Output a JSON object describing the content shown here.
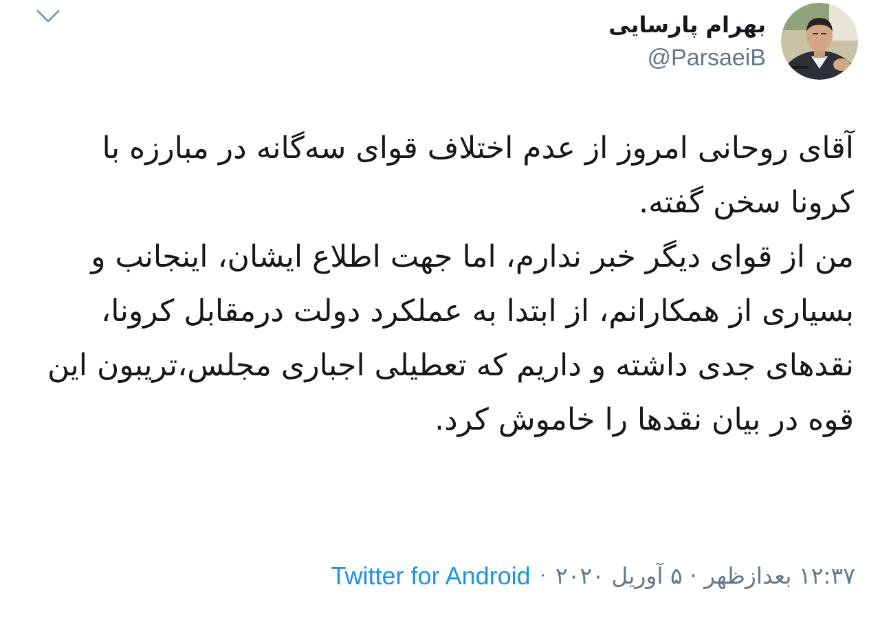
{
  "tweet": {
    "author": {
      "display_name": "بهرام پارسایی",
      "handle": "@ParsaeiB"
    },
    "paragraphs": [
      "آقای روحانی امروز از عدم اختلاف قوای سه‌گانه در مبارزه با کرونا سخن گفته.",
      "من از قوای دیگر خبر ندارم، اما جهت اطلاع ایشان، اینجانب و بسیاری از همکارانم، از ابتدا به عملکرد دولت درمقابل کرونا، نقدهای جدی داشته و داریم که تعطیلی اجباری مجلس،تریبون این قوه در بیان نقدها را خاموش کرد."
    ],
    "timestamp": "۱۲:۳۷ بعدازظهر · ۵ آوریل ۲۰۲۰",
    "separator": "·",
    "source": "Twitter for Android"
  },
  "colors": {
    "text": "#14171a",
    "secondary": "#657786",
    "link": "#1b95e0"
  },
  "icons": {
    "menu": "chevron-down-icon"
  }
}
